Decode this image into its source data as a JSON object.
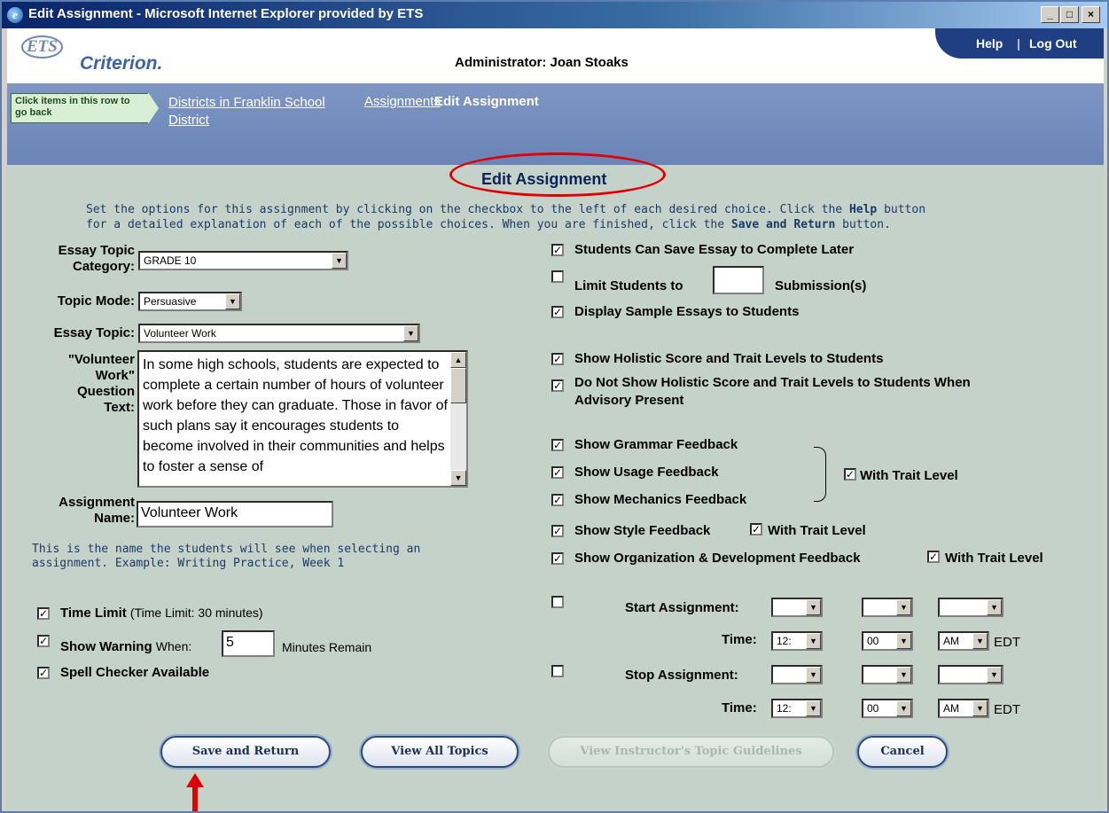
{
  "window": {
    "title": "Edit Assignment - Microsoft Internet Explorer provided by ETS",
    "minimize": "_",
    "maximize": "□",
    "close": "×"
  },
  "header": {
    "logo_ets": "ETS",
    "logo_criterion": "Criterion.",
    "administrator": "Administrator: Joan Stoaks",
    "help": "Help",
    "logout": "Log Out"
  },
  "breadcrumb": {
    "back_hint": "Click items in this row to go back",
    "items": [
      "Districts in Franklin School District",
      "Assignments"
    ],
    "current": "Edit Assignment"
  },
  "page": {
    "title": "Edit Assignment",
    "instructions_1a": "Set the options for this assignment by clicking on the checkbox to the left of each desired choice. Click the ",
    "instructions_help": "Help",
    "instructions_1b": " button",
    "instructions_2a": "for a detailed explanation of each of the possible choices. When you are finished, click the ",
    "instructions_save": "Save and Return",
    "instructions_2b": " button."
  },
  "form": {
    "essay_category_label_1": "Essay Topic",
    "essay_category_label_2": "Category:",
    "essay_category_value": "GRADE 10",
    "topic_mode_label": "Topic Mode:",
    "topic_mode_value": "Persuasive",
    "essay_topic_label": "Essay Topic:",
    "essay_topic_value": "Volunteer Work",
    "question_label_1": "\"Volunteer",
    "question_label_2": "Work\"",
    "question_label_3": "Question",
    "question_label_4": "Text:",
    "question_text": "In some high schools, students are expected to complete a certain number of hours of volunteer work before they can graduate. Those in favor of such plans say it encourages students to become involved in their communities and helps to foster a sense of",
    "assignment_name_label_1": "Assignment",
    "assignment_name_label_2": "Name:",
    "assignment_name_value": "Volunteer Work",
    "name_note_1": "This is the name the students will see when selecting an",
    "name_note_2": "assignment. Example: Writing Practice, Week 1",
    "time_limit_label": "Time Limit",
    "time_limit_detail": "(Time Limit: 30 minutes)",
    "show_warning_label": "Show Warning",
    "show_warning_when": "When:",
    "show_warning_value": "5",
    "show_warning_suffix": "Minutes Remain",
    "spell_checker_label": "Spell Checker Available",
    "check_mark": "✓"
  },
  "options": {
    "save_later": "Students Can Save Essay to Complete Later",
    "limit_students": "Limit Students to",
    "limit_value": "",
    "submissions": "Submission(s)",
    "display_samples": "Display Sample Essays to Students",
    "show_holistic": "Show Holistic Score and Trait Levels to Students",
    "dont_show_holistic_1": "Do Not Show Holistic Score and Trait Levels to Students When",
    "dont_show_holistic_2": "Advisory Present",
    "grammar": "Show Grammar Feedback",
    "usage": "Show Usage Feedback",
    "mechanics": "Show Mechanics Feedback",
    "with_trait_level": "With Trait Level",
    "style": "Show Style Feedback",
    "organization": "Show Organization & Development Feedback"
  },
  "schedule": {
    "start_label": "Start Assignment:",
    "stop_label": "Stop Assignment:",
    "time_label": "Time:",
    "hour_value": "12:",
    "minute_value": "00",
    "ampm_value": "AM",
    "timezone": "EDT"
  },
  "buttons": {
    "save_return": "Save and Return",
    "view_all": "View All Topics",
    "view_guidelines": "View Instructor's Topic Guidelines",
    "cancel": "Cancel"
  },
  "colors": {
    "content_bg": "#c5d2c9",
    "header_bar": "#1f3f82",
    "crumb_bar": "#7088b8",
    "annotation_red": "#e00000"
  }
}
